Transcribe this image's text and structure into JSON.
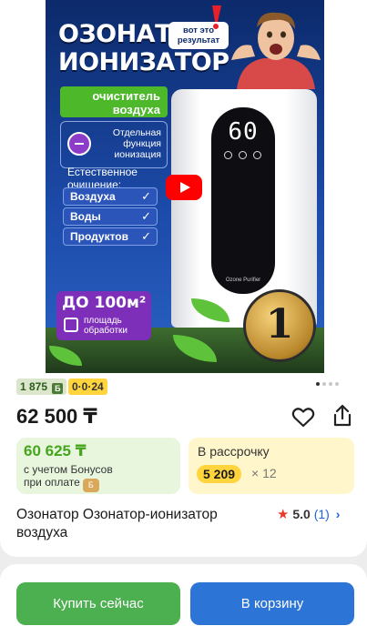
{
  "banner": {
    "title_line1": "ОЗОНАТОР",
    "title_line2": "ИОНИЗАТОР",
    "bubble_line1": "вот это",
    "bubble_line2": "результат",
    "green_label_line1": "очиститель",
    "green_label_line2": "воздуха",
    "feature_line1": "Отдельная",
    "feature_line2": "функция",
    "feature_line3": "ионизация",
    "natural_line1": "Естественное",
    "natural_line2": "очищение:",
    "pills": [
      "Воздуха",
      "Воды",
      "Продуктов"
    ],
    "check_glyph": "✓",
    "display_digits": "60",
    "device_label": "Ozone Purifier",
    "area_big": "ДО 100м²",
    "area_small_line1": "площадь",
    "area_small_line2": "обработки",
    "medal_text": "1"
  },
  "carousel": {
    "count": 4,
    "active": 0
  },
  "badges": {
    "bonus": "1 875",
    "bonus_icon": "Б",
    "installment": "0·0·24"
  },
  "price": "62 500 ₸",
  "bonus_box": {
    "price": "60 625 ₸",
    "note_line1": "с учетом Бонусов",
    "note_line2": "при оплате",
    "icon_text": "Б"
  },
  "installment_box": {
    "label": "В рассрочку",
    "amount": "5 209",
    "months": "× 12"
  },
  "product_title": "Озонатор Озонатор-ионизатор воздуха",
  "rating": {
    "star": "★",
    "value": "5.0",
    "count": "(1)",
    "chevron": "›"
  },
  "buttons": {
    "buy": "Купить сейчас",
    "cart": "В корзину"
  },
  "colors": {
    "accent_green": "#4caf50",
    "accent_blue": "#2c74d6",
    "yellow": "#ffd43d",
    "bonus_green": "#45a51d"
  }
}
